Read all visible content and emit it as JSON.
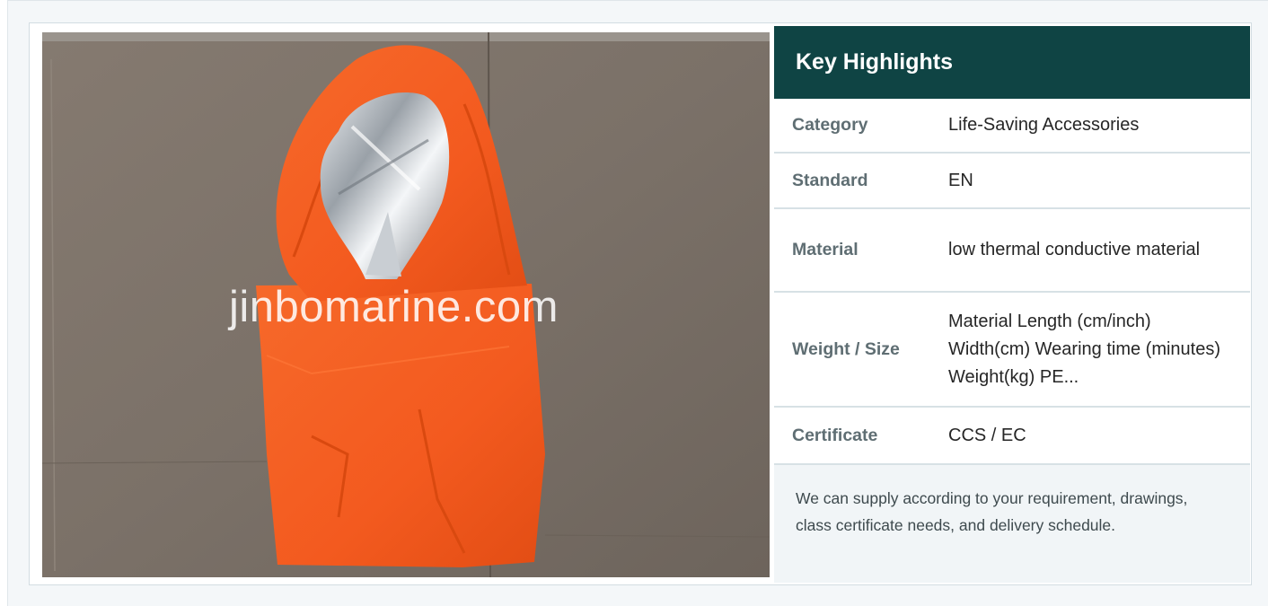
{
  "watermark": "jinbomarine.com",
  "highlights": {
    "title": "Key Highlights",
    "rows": [
      {
        "label": "Category",
        "value": "Life-Saving Accessories"
      },
      {
        "label": "Standard",
        "value": "EN"
      },
      {
        "label": "Material",
        "value": "low thermal conductive material"
      },
      {
        "label": "Weight / Size",
        "value": "Material Length (cm/inch) Width(cm) Wearing time (minutes) Weight(kg) PE..."
      },
      {
        "label": "Certificate",
        "value": "CCS / EC"
      }
    ],
    "note": "We can supply according to your requirement, drawings, class certificate needs, and delivery schedule."
  },
  "colors": {
    "header_bg": "#0f4444",
    "suit_orange": "#f35a1f",
    "page_bg": "#f4f7f9"
  }
}
